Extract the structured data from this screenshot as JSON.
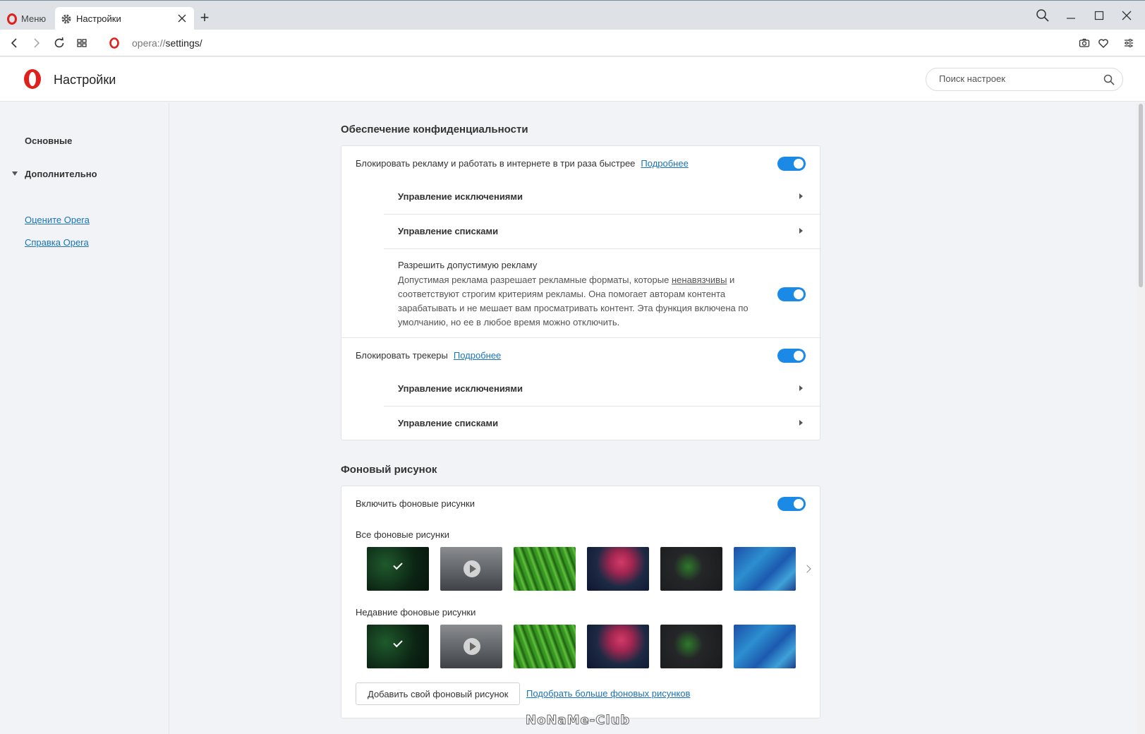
{
  "tabs": {
    "menu_label": "Меню",
    "active_label": "Настройки"
  },
  "address": {
    "scheme": "opera://",
    "path": "settings/"
  },
  "header": {
    "title": "Настройки",
    "search_placeholder": "Поиск настроек"
  },
  "sidebar": {
    "basic": "Основные",
    "advanced": "Дополнительно",
    "rate_link": "Оцените Opera",
    "help_link": "Справка Opera"
  },
  "privacy": {
    "title": "Обеспечение конфиденциальности",
    "block_ads": "Блокировать рекламу и работать в интернете в три раза быстрее",
    "block_ads_more": "Подробнее",
    "block_ads_on": true,
    "manage_exceptions": "Управление исключениями",
    "manage_lists": "Управление списками",
    "acceptable_ads_title": "Разрешить допустимую рекламу",
    "acceptable_ads_desc_1": "Допустимая реклама разрешает рекламные форматы, которые",
    "acceptable_ads_desc_ul": "ненавязчивы",
    "acceptable_ads_desc_2": "и соответствуют строгим критериям рекламы. Она помогает авторам контента зарабатывать и не мешает вам просматривать контент. Эта функция включена по умолчанию, но ее в любое время можно отключить.",
    "acceptable_ads_on": true,
    "block_trackers": "Блокировать трекеры",
    "block_trackers_more": "Подробнее",
    "block_trackers_on": true,
    "trackers_exceptions": "Управление исключениями",
    "trackers_lists": "Управление списками"
  },
  "wallpaper": {
    "title": "Фоновый рисунок",
    "enable": "Включить фоновые рисунки",
    "enable_on": true,
    "all_label": "Все фоновые рисунки",
    "recent_label": "Недавние фоновые рисунки",
    "add_button": "Добавить свой фоновый рисунок",
    "more_link": "Подобрать больше фоновых рисунков"
  },
  "watermark": "NoNaMe-Club",
  "colors": {
    "accent": "#1a8ae6",
    "link": "#1a73b8",
    "opera_red": "#e0211b"
  }
}
